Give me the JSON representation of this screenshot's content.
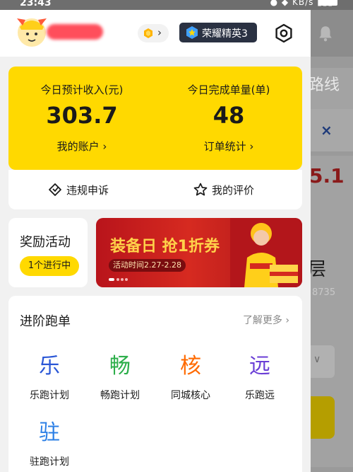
{
  "status": {
    "time": "23:43",
    "right_icons": "KB/s"
  },
  "header": {
    "rank_badge": "荣耀精英3"
  },
  "income": {
    "left": {
      "label": "今日预计收入(元)",
      "value": "303.7",
      "link": "我的账户 ›"
    },
    "right": {
      "label": "今日完成单量(单)",
      "value": "48",
      "link": "订单统计 ›"
    }
  },
  "actions": [
    {
      "label": "违规申诉",
      "icon": "appeal-icon"
    },
    {
      "label": "我的评价",
      "icon": "star-icon"
    }
  ],
  "reward": {
    "title": "奖励活动",
    "count_pill": "1个进行中"
  },
  "banner": {
    "headline": "装备日 抢1折券",
    "date": "活动时间2.27-2.28"
  },
  "advanced": {
    "title": "进阶跑单",
    "more": "了解更多 ›",
    "items": [
      {
        "glyph": "乐",
        "name": "乐跑计划",
        "color": "#2b57d6"
      },
      {
        "glyph": "畅",
        "name": "畅跑计划",
        "color": "#2cae4a"
      },
      {
        "glyph": "核",
        "name": "同城核心",
        "color": "#ff6a00"
      },
      {
        "glyph": "远",
        "name": "乐跑远",
        "color": "#6a3ed6"
      },
      {
        "glyph": "驻",
        "name": "驻跑计划",
        "color": "#2b7fe6"
      }
    ]
  },
  "background_page": {
    "route_label": "路线",
    "close": "×",
    "amount": "5.1",
    "layer": "层",
    "sub": "8735"
  },
  "colors": {
    "brand_yellow": "#ffd900",
    "badge_dark": "#2a3142",
    "banner_red": "#c91d1d"
  }
}
